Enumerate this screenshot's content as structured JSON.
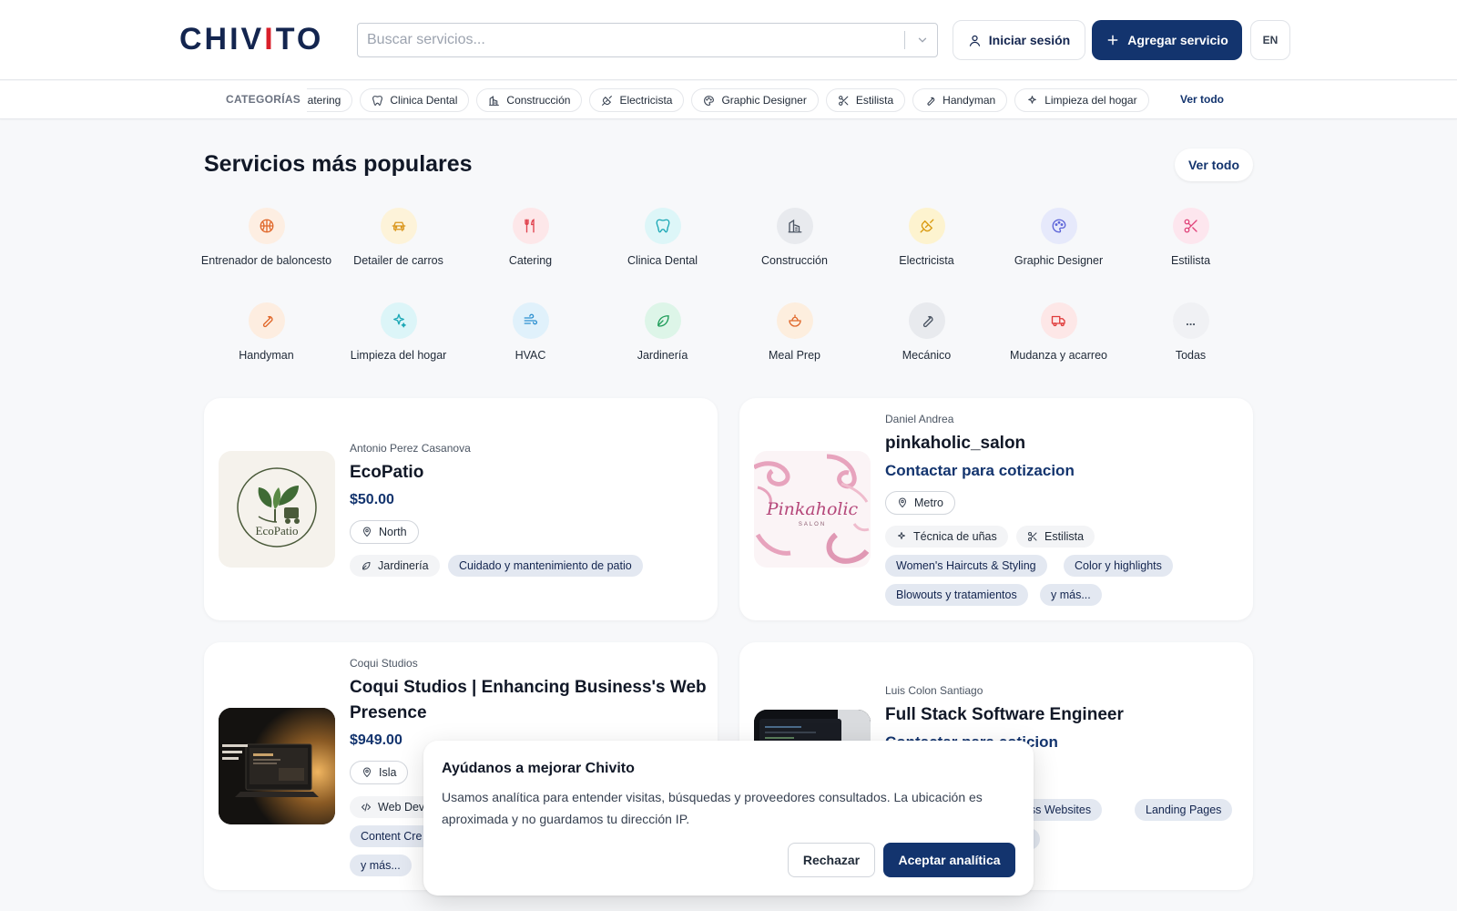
{
  "header": {
    "logo_before": "CHIV",
    "logo_accent": "I",
    "logo_after": "TO",
    "search_placeholder": "Buscar servicios...",
    "login_label": "Iniciar sesión",
    "add_label": "Agregar servicio",
    "lang_label": "EN"
  },
  "categories_bar": {
    "label": "CATEGORÍAS",
    "chips": [
      {
        "label": "Catering",
        "icon": "utensils-icon"
      },
      {
        "label": "Clinica Dental",
        "icon": "tooth-icon"
      },
      {
        "label": "Construcción",
        "icon": "building-icon"
      },
      {
        "label": "Electricista",
        "icon": "plug-icon"
      },
      {
        "label": "Graphic Designer",
        "icon": "palette-icon"
      },
      {
        "label": "Estilista",
        "icon": "scissors-icon"
      },
      {
        "label": "Handyman",
        "icon": "wrench-icon"
      },
      {
        "label": "Limpieza del hogar",
        "icon": "sparkles-icon"
      }
    ],
    "view_all": "Ver todo"
  },
  "popular": {
    "title": "Servicios más populares",
    "view_all": "Ver todo",
    "items": [
      {
        "label": "Entrenador de baloncesto",
        "icon": "basketball-icon",
        "bg": "#fdeee2",
        "fg": "#e0672a"
      },
      {
        "label": "Detailer de carros",
        "icon": "car-icon",
        "bg": "#fdf3d9",
        "fg": "#d9951a"
      },
      {
        "label": "Catering",
        "icon": "utensils-icon",
        "bg": "#fde7e9",
        "fg": "#e0434f"
      },
      {
        "label": "Clinica Dental",
        "icon": "tooth-icon",
        "bg": "#ddf6f8",
        "fg": "#1aa7b5"
      },
      {
        "label": "Construcción",
        "icon": "building-icon",
        "bg": "#e8eaee",
        "fg": "#4b5563"
      },
      {
        "label": "Electricista",
        "icon": "plug-icon",
        "bg": "#fdf3cf",
        "fg": "#d99a10"
      },
      {
        "label": "Graphic Designer",
        "icon": "palette-icon",
        "bg": "#e6e9fb",
        "fg": "#5b63d8"
      },
      {
        "label": "Estilista",
        "icon": "scissors-icon",
        "bg": "#fde6ee",
        "fg": "#e0437a"
      },
      {
        "label": "Handyman",
        "icon": "wrench-icon",
        "bg": "#fdede0",
        "fg": "#e0672a"
      },
      {
        "label": "Limpieza del hogar",
        "icon": "sparkles-icon",
        "bg": "#dcf5f8",
        "fg": "#1aa7b5"
      },
      {
        "label": "HVAC",
        "icon": "wind-icon",
        "bg": "#e0f1fb",
        "fg": "#2b8fd0"
      },
      {
        "label": "Jardinería",
        "icon": "leaf-icon",
        "bg": "#ddf5e8",
        "fg": "#1f9d5a"
      },
      {
        "label": "Meal Prep",
        "icon": "salad-bowl-icon",
        "bg": "#fdeede",
        "fg": "#e0672a"
      },
      {
        "label": "Mecánico",
        "icon": "wrench-icon",
        "bg": "#e8eaee",
        "fg": "#4b5563"
      },
      {
        "label": "Mudanza y acarreo",
        "icon": "truck-icon",
        "bg": "#fde7e7",
        "fg": "#e03b3b"
      },
      {
        "label": "Todas",
        "icon": "more-icon",
        "bg": "#f0f1f4",
        "fg": "#4b5563"
      }
    ]
  },
  "cards": [
    {
      "owner": "Antonio Perez Casanova",
      "title": "EcoPatio",
      "price": "$50.00",
      "location": "North",
      "category": "Jardinería",
      "tags": [
        "Cuidado y mantenimiento de patio"
      ],
      "logo_text": "EcoPatio"
    },
    {
      "owner": "Daniel Andrea",
      "title": "pinkaholic_salon",
      "price": "Contactar para cotizacion",
      "location": "Metro",
      "categories": [
        "Técnica de uñas",
        "Estilista"
      ],
      "tags": [
        "Women's Haircuts & Styling",
        "Color y highlights",
        "Blowouts y tratamientos",
        "y más..."
      ],
      "logo_text": "Pinkaholic",
      "logo_sub": "SALON"
    },
    {
      "owner": "Coqui Studios",
      "title_line1": "Coqui Studios | Enhancing Business's Web",
      "title_line2": "Presence",
      "price": "$949.00",
      "location": "Isla",
      "category": "Web Dev",
      "tags": [
        "Content Cre",
        "y más..."
      ]
    },
    {
      "owner": "Luis Colon Santiago",
      "title": "Full Stack Software Engineer",
      "price_visible": "cion",
      "tags": [
        "siness Websites",
        "Landing Pages"
      ]
    }
  ],
  "consent": {
    "title": "Ayúdanos a mejorar Chivito",
    "body": "Usamos analítica para entender visitas, búsquedas y proveedores consultados. La ubicación es aproximada y no guardamos tu dirección IP.",
    "reject": "Rechazar",
    "accept": "Aceptar analítica"
  }
}
